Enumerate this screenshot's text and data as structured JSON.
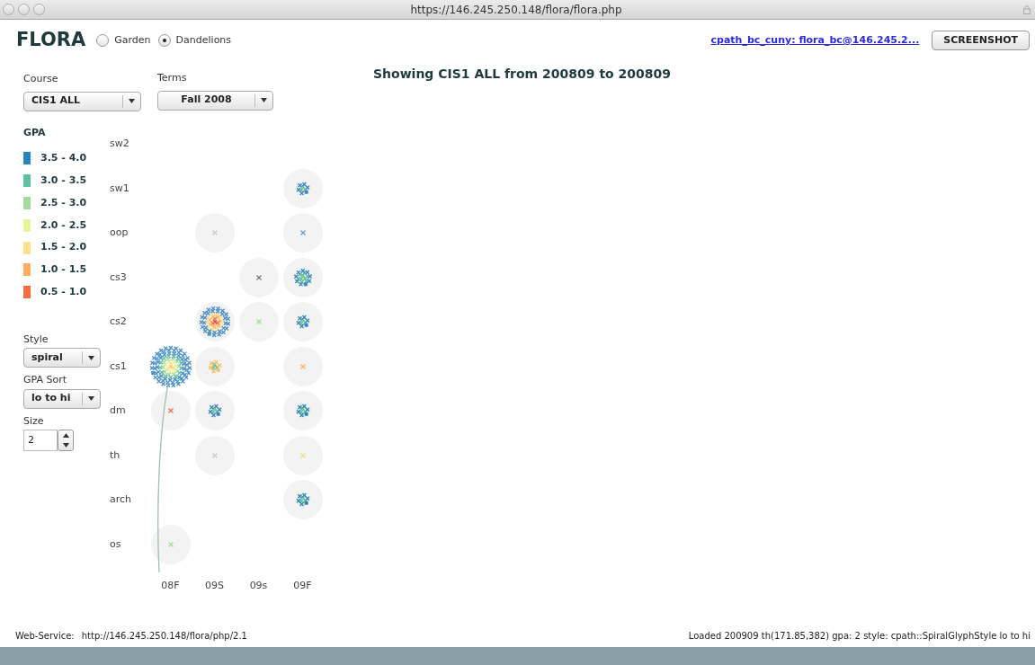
{
  "window": {
    "title": "https://146.245.250.148/flora/flora.php"
  },
  "header": {
    "logo": "FLORA",
    "modes": [
      {
        "label": "Garden",
        "selected": false
      },
      {
        "label": "Dandelions",
        "selected": true
      }
    ],
    "user_link": "cpath_bc_cuny: flora_bc@146.245.2...",
    "screenshot_button": "SCREENSHOT"
  },
  "filters": [
    {
      "label": "Course",
      "value": "CIS1 ALL"
    },
    {
      "label": "Terms",
      "value": "Fall 2008"
    }
  ],
  "legend": {
    "title": "GPA",
    "items": [
      {
        "label": "3.5 - 4.0",
        "color": "#2b83ba"
      },
      {
        "label": "3.0 - 3.5",
        "color": "#5fc0a0"
      },
      {
        "label": "2.5 - 3.0",
        "color": "#a6d9a0"
      },
      {
        "label": "2.0 - 2.5",
        "color": "#e6f598"
      },
      {
        "label": "1.5 - 2.0",
        "color": "#fee08b"
      },
      {
        "label": "1.0 - 1.5",
        "color": "#fdae61"
      },
      {
        "label": "0.5 - 1.0",
        "color": "#f46d43"
      }
    ]
  },
  "options": [
    {
      "label": "Style",
      "value": "spiral"
    },
    {
      "label": "GPA Sort",
      "value": "lo to hi"
    }
  ],
  "size": {
    "label": "Size",
    "value": "2"
  },
  "heading": "Showing CIS1 ALL from 200809 to 200809",
  "grid": {
    "columns": [
      "08F",
      "09S",
      "09s",
      "09F"
    ],
    "rows": [
      {
        "label": "sw2",
        "cells": [
          {
            "kind": "empty"
          },
          {
            "kind": "empty"
          },
          {
            "kind": "empty"
          },
          {
            "kind": "empty"
          }
        ]
      },
      {
        "label": "sw1",
        "cells": [
          {
            "kind": "empty"
          },
          {
            "kind": "empty"
          },
          {
            "kind": "empty"
          },
          {
            "kind": "blob",
            "color": "#3a86c0"
          }
        ]
      },
      {
        "label": "oop",
        "cells": [
          {
            "kind": "empty"
          },
          {
            "kind": "x",
            "color": "#c8c8c8"
          },
          {
            "kind": "empty"
          },
          {
            "kind": "x",
            "color": "#5b9bd0"
          }
        ]
      },
      {
        "label": "cs3",
        "cells": [
          {
            "kind": "empty"
          },
          {
            "kind": "empty"
          },
          {
            "kind": "x",
            "color": "#777777"
          },
          {
            "kind": "ring",
            "color": "#3a86c0"
          }
        ]
      },
      {
        "label": "cs2",
        "cells": [
          {
            "kind": "empty"
          },
          {
            "kind": "burst",
            "color": "#4a90c8"
          },
          {
            "kind": "x",
            "color": "#a6d9a0"
          },
          {
            "kind": "blob",
            "color": "#3a86c0"
          }
        ]
      },
      {
        "label": "cs1",
        "cells": [
          {
            "kind": "bloom",
            "color": "#4a90c8"
          },
          {
            "kind": "blob",
            "color": "#fdc061"
          },
          {
            "kind": "empty"
          },
          {
            "kind": "x",
            "color": "#fdae61"
          }
        ]
      },
      {
        "label": "dm",
        "cells": [
          {
            "kind": "x",
            "color": "#f46d43"
          },
          {
            "kind": "blob",
            "color": "#3a86c0"
          },
          {
            "kind": "empty"
          },
          {
            "kind": "blob",
            "color": "#2b83ba"
          }
        ]
      },
      {
        "label": "th",
        "cells": [
          {
            "kind": "empty"
          },
          {
            "kind": "x",
            "color": "#c8c8c8"
          },
          {
            "kind": "empty"
          },
          {
            "kind": "x",
            "color": "#e6e680"
          }
        ]
      },
      {
        "label": "arch",
        "cells": [
          {
            "kind": "empty"
          },
          {
            "kind": "empty"
          },
          {
            "kind": "empty"
          },
          {
            "kind": "blob",
            "color": "#2b83ba"
          }
        ]
      },
      {
        "label": "os",
        "cells": [
          {
            "kind": "x",
            "color": "#a6d9a0"
          },
          {
            "kind": "empty"
          },
          {
            "kind": "empty"
          },
          {
            "kind": "empty"
          }
        ]
      }
    ]
  },
  "status_bar": {
    "service_label": "Web-Service:",
    "service_url": "http://146.245.250.148/flora/php/2.1",
    "message": "Loaded 200909 th(171.85,382) gpa: 2 style: cpath::SpiralGlyphStyle lo to hi"
  }
}
